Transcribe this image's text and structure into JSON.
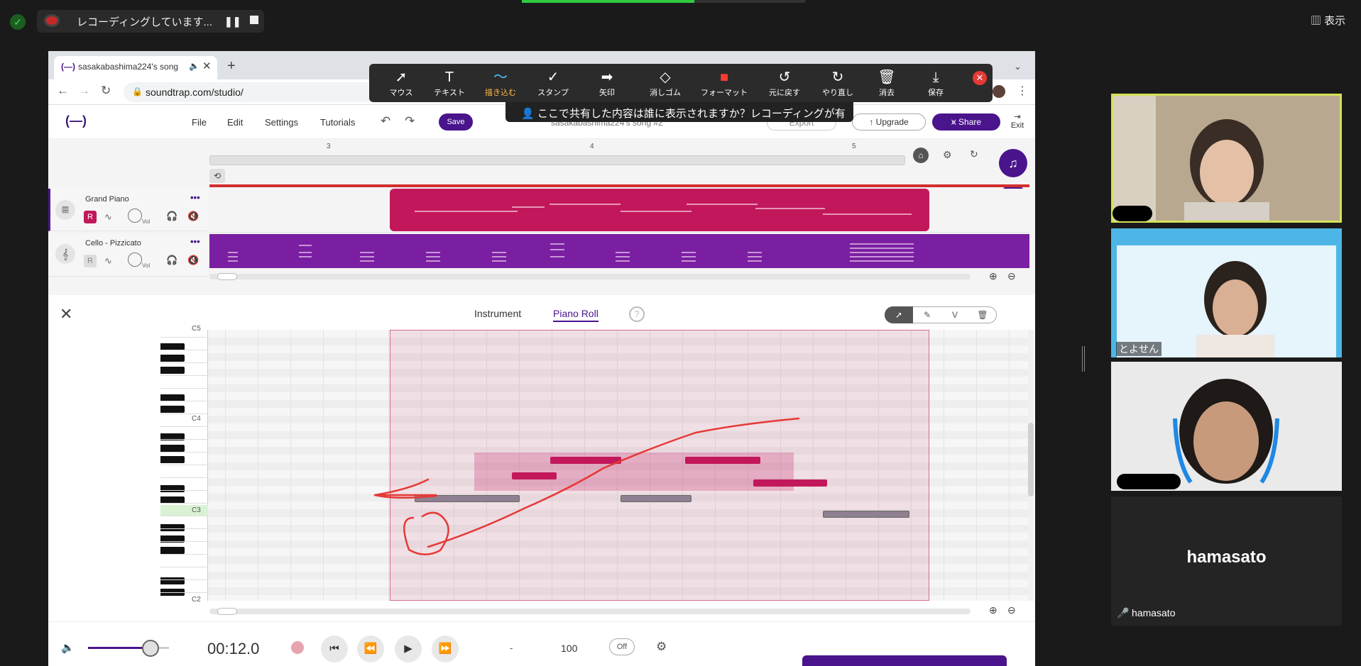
{
  "zoom": {
    "recording_text": "レコーディングしています...",
    "view_label": "表示",
    "share_banner": "ここで共有した内容は誰に表示されますか？レコーディングが有効",
    "annotate_tools": [
      {
        "label": "マウス",
        "icon": "➚"
      },
      {
        "label": "テキスト",
        "icon": "T"
      },
      {
        "label": "描き込む",
        "icon": "〜",
        "active": true
      },
      {
        "label": "スタンプ",
        "icon": "✓"
      },
      {
        "label": "矢印",
        "icon": "➡"
      },
      {
        "label": "消しゴム",
        "icon": "◇"
      },
      {
        "label": "フォーマット",
        "icon": "■"
      },
      {
        "label": "元に戻す",
        "icon": "↺"
      },
      {
        "label": "やり直し",
        "icon": "↻"
      },
      {
        "label": "消去",
        "icon": "🗑"
      },
      {
        "label": "保存",
        "icon": "⤓"
      }
    ],
    "participants": [
      {
        "name": "",
        "highlighted": true
      },
      {
        "name": "とよせん"
      },
      {
        "name": ""
      },
      {
        "name": "hamasato",
        "display": "hamasato",
        "muted": true
      }
    ]
  },
  "browser": {
    "tab_title": "sasakabashima224's song",
    "url": "soundtrap.com/studio/"
  },
  "soundtrap": {
    "logo": "(—)",
    "menu": [
      "File",
      "Edit",
      "Settings",
      "Tutorials"
    ],
    "save_label": "Save",
    "song_name": "sasakabashima224's song #2",
    "export_label": "Export",
    "upgrade_label": "Upgrade",
    "share_label": "Share",
    "exit_label": "Exit",
    "ruler_marks": [
      "3",
      "4",
      "5"
    ],
    "tracks": [
      {
        "name": "Grand Piano",
        "rec": "R"
      },
      {
        "name": "Cello - Pizzicato",
        "rec": "R"
      }
    ],
    "vol_label": "Vol"
  },
  "piano_roll": {
    "tab_instrument": "Instrument",
    "tab_piano_roll": "Piano Roll",
    "help": "?",
    "tool_velocity": "V",
    "key_labels": {
      "top": "C5",
      "c4": "C4",
      "c3": "C3",
      "bottom": "C2"
    }
  },
  "transport": {
    "time": "00:12.0",
    "key": "-",
    "tempo": "100",
    "metronome": "Off"
  },
  "colors": {
    "accent": "#4a148c",
    "clip": "#c2185b",
    "cello": "#7b1fa2",
    "annotation": "#e53935"
  }
}
